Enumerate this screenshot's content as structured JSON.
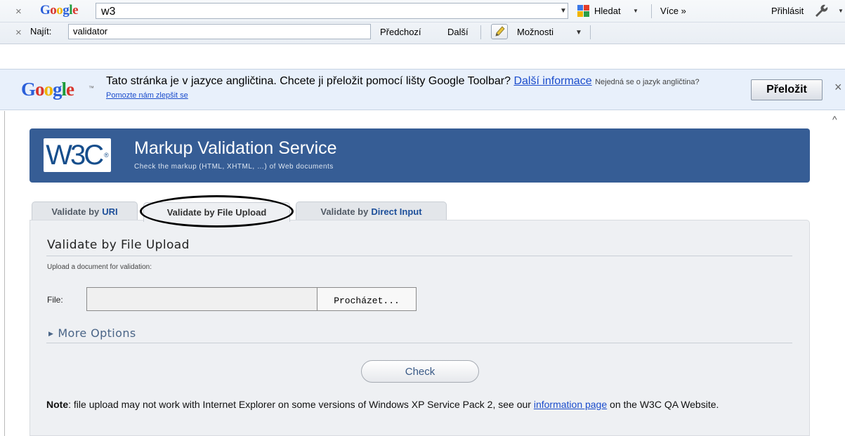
{
  "toolbar": {
    "close_symbol": "×",
    "google_logo": "Google",
    "search_value": "w3",
    "search_button": "Hledat",
    "more_label": "Více »",
    "signin_label": "Přihlásit",
    "find_label": "Najít:",
    "find_value": "validator",
    "prev_label": "Předchozí",
    "next_label": "Další",
    "options_label": "Možnosti",
    "icons": [
      "close-icon",
      "search-engine-icon",
      "wrench-icon",
      "pencil-icon",
      "dropdown-arrow-icon"
    ]
  },
  "translate_bar": {
    "logo": "Google",
    "message": "Tato stránka je v jazyce angličtina. Chcete ji přeložit pomocí lišty Google Toolbar?",
    "more_info_link": "Další informace",
    "not_english": "Nejedná se o jazyk angličtina?",
    "help_link": "Pomozte nám zlepšit se",
    "translate_button": "Přeložit",
    "close_symbol": "×"
  },
  "header": {
    "logo_text": "W3C",
    "logo_reg": "®",
    "title": "Markup Validation Service",
    "subtitle": "Check the markup (HTML, XHTML, …) of Web documents",
    "background_color": "#365d95"
  },
  "tabs": [
    {
      "prefix": "Validate by",
      "label": "URI",
      "active": false
    },
    {
      "prefix": "Validate by File Upload",
      "label": "",
      "active": true
    },
    {
      "prefix": "Validate by",
      "label": "Direct Input",
      "active": false
    }
  ],
  "panel": {
    "title": "Validate by File Upload",
    "description": "Upload a document for validation:",
    "file_label": "File:",
    "file_value": "",
    "browse_button": "Procházet...",
    "more_options": "More Options",
    "check_button": "Check",
    "note_bold": "Note",
    "note_text": ": file upload may not work with Internet Explorer on some versions of Windows XP Service Pack 2, see our ",
    "note_link": "information page",
    "note_end": " on the W3C QA Website."
  }
}
